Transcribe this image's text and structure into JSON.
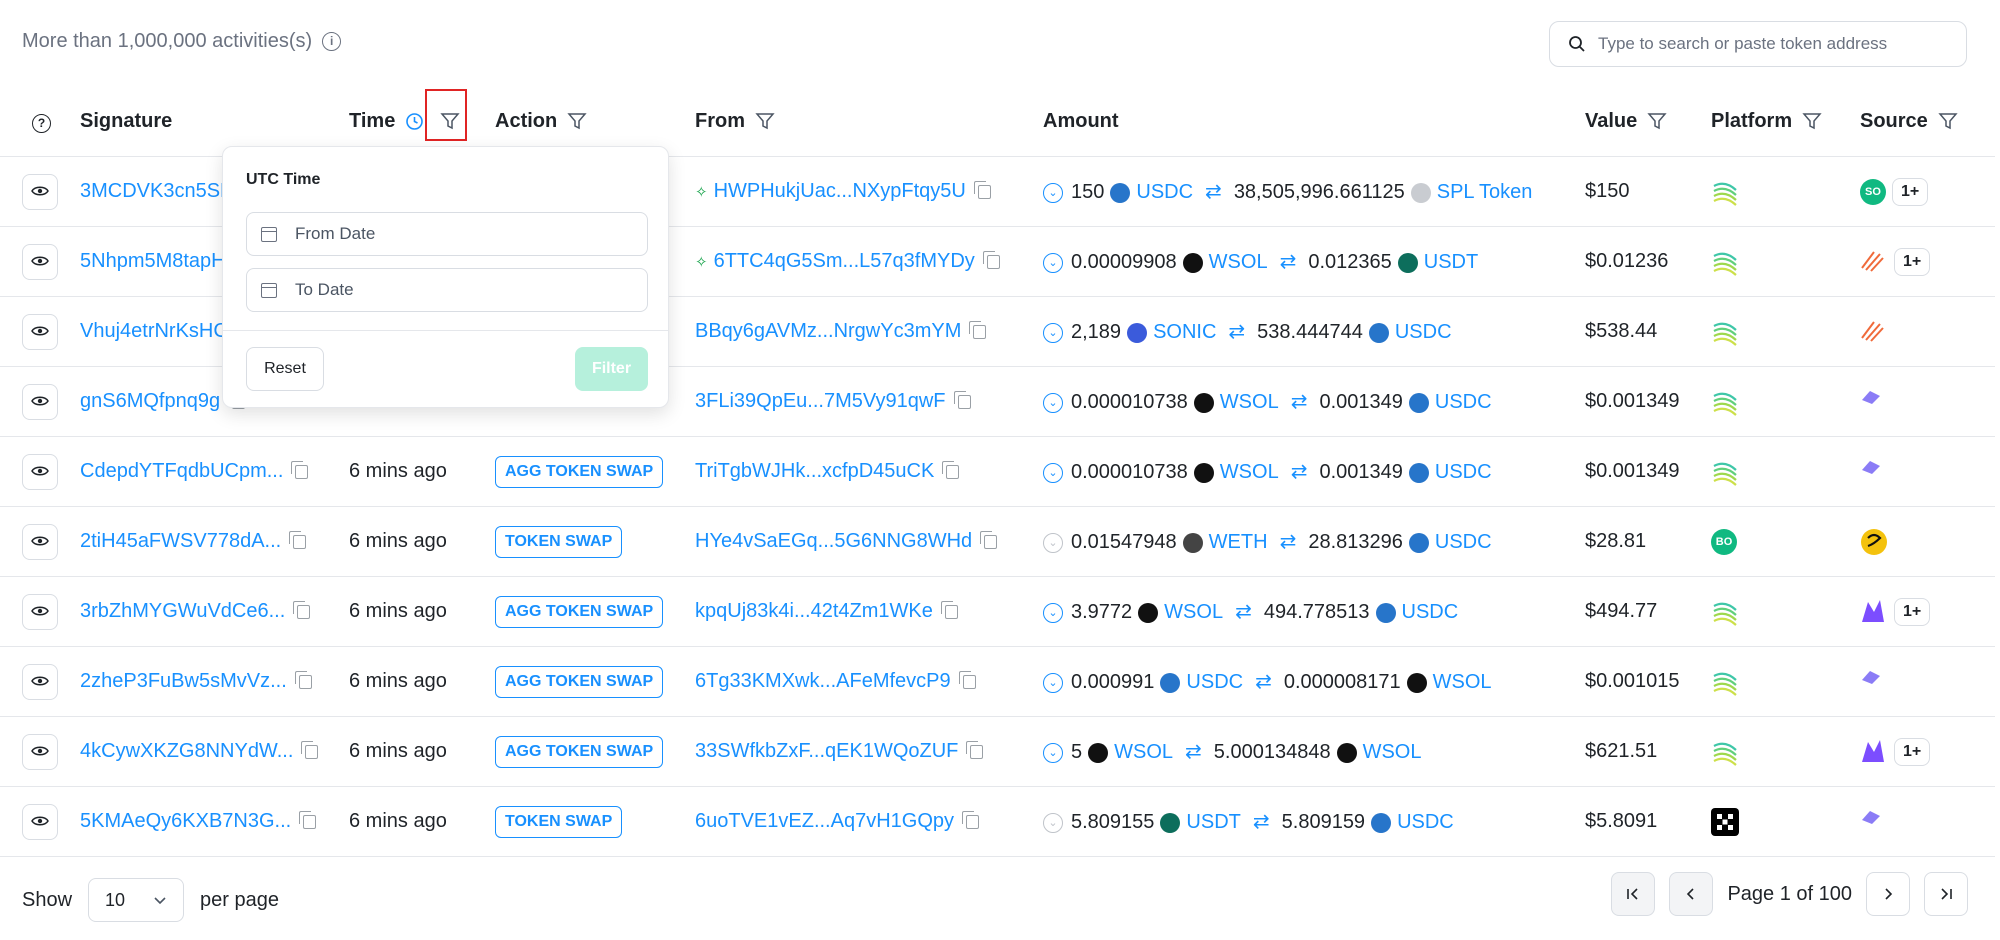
{
  "header": {
    "activity_count": "More than 1,000,000 activities(s)",
    "search_placeholder": "Type to search or paste token address"
  },
  "columns": {
    "signature": "Signature",
    "time": "Time",
    "action": "Action",
    "from": "From",
    "amount": "Amount",
    "value": "Value",
    "platform": "Platform",
    "source": "Source"
  },
  "rows": [
    {
      "sig": "3MCDVK3cn5SD",
      "time": "",
      "action": "",
      "from": "HWPHukjUac...NXypFtqy5U",
      "a1": "150",
      "t1": "USDC",
      "a2": "38,505,996.661125",
      "t2": "SPL Token",
      "value": "$150",
      "platform": "wave",
      "source_badge": "SO",
      "more": "1+"
    },
    {
      "sig": "5Nhpm5M8tapH",
      "time": "",
      "action": "",
      "from": "6TTC4qG5Sm...L57q3fMYDy",
      "a1": "0.00009908",
      "t1": "WSOL",
      "a2": "0.012365",
      "t2": "USDT",
      "value": "$0.01236",
      "platform": "wave",
      "source_badge": "",
      "more": "1+"
    },
    {
      "sig": "Vhuj4etrNrKsHC",
      "time": "",
      "action": "",
      "from": "BBqy6gAVMz...NrgwYc3mYM",
      "a1": "2,189",
      "t1": "SONIC",
      "a2": "538.444744",
      "t2": "USDC",
      "value": "$538.44",
      "platform": "wave",
      "source_badge": "",
      "more": ""
    },
    {
      "sig": "gnS6MQfpnq9g",
      "time": "",
      "action": "",
      "from": "3FLi39QpEu...7M5Vy91qwF",
      "a1": "0.000010738",
      "t1": "WSOL",
      "a2": "0.001349",
      "t2": "USDC",
      "value": "$0.001349",
      "platform": "wave",
      "source_badge": "",
      "more": ""
    },
    {
      "sig": "CdepdYTFqdbUCpm...",
      "time": "6 mins ago",
      "action": "AGG TOKEN SWAP",
      "from": "TriTgbWJHk...xcfpD45uCK",
      "a1": "0.000010738",
      "t1": "WSOL",
      "a2": "0.001349",
      "t2": "USDC",
      "value": "$0.001349",
      "platform": "wave",
      "source_badge": "",
      "more": ""
    },
    {
      "sig": "2tiH45aFWSV778dA...",
      "time": "6 mins ago",
      "action": "TOKEN SWAP",
      "from": "HYe4vSaEGq...5G6NNG8WHd",
      "a1": "0.01547948",
      "t1": "WETH",
      "a2": "28.813296",
      "t2": "USDC",
      "value": "$28.81",
      "platform": "BO",
      "source_badge": "",
      "more": ""
    },
    {
      "sig": "3rbZhMYGWuVdCe6...",
      "time": "6 mins ago",
      "action": "AGG TOKEN SWAP",
      "from": "kpqUj83k4i...42t4Zm1WKe",
      "a1": "3.9772",
      "t1": "WSOL",
      "a2": "494.778513",
      "t2": "USDC",
      "value": "$494.77",
      "platform": "wave",
      "source_badge": "",
      "more": "1+"
    },
    {
      "sig": "2zheP3FuBw5sMvVz...",
      "time": "6 mins ago",
      "action": "AGG TOKEN SWAP",
      "from": "6Tg33KMXwk...AFeMfevcP9",
      "a1": "0.000991",
      "t1": "USDC",
      "a2": "0.000008171",
      "t2": "WSOL",
      "value": "$0.001015",
      "platform": "wave",
      "source_badge": "",
      "more": ""
    },
    {
      "sig": "4kCywXKZG8NNYdW...",
      "time": "6 mins ago",
      "action": "AGG TOKEN SWAP",
      "from": "33SWfkbZxF...qEK1WQoZUF",
      "a1": "5",
      "t1": "WSOL",
      "a2": "5.000134848",
      "t2": "WSOL",
      "value": "$621.51",
      "platform": "wave",
      "source_badge": "",
      "more": "1+"
    },
    {
      "sig": "5KMAeQy6KXB7N3G...",
      "time": "6 mins ago",
      "action": "TOKEN SWAP",
      "from": "6uoTVE1vEZ...Aq7vH1GQpy",
      "a1": "5.809155",
      "t1": "USDT",
      "a2": "5.809159",
      "t2": "USDC",
      "value": "$5.8091",
      "platform": "okx",
      "source_badge": "",
      "more": ""
    }
  ],
  "popup": {
    "title": "UTC Time",
    "from_placeholder": "From Date",
    "to_placeholder": "To Date",
    "reset": "Reset",
    "filter": "Filter"
  },
  "footer": {
    "show": "Show",
    "per_page_value": "10",
    "per_page": "per page",
    "page_text": "Page 1 of 100"
  },
  "colors": {
    "accent": "#1890ff",
    "highlight": "#e02424",
    "filter_disabled": "#b6f0dc"
  }
}
